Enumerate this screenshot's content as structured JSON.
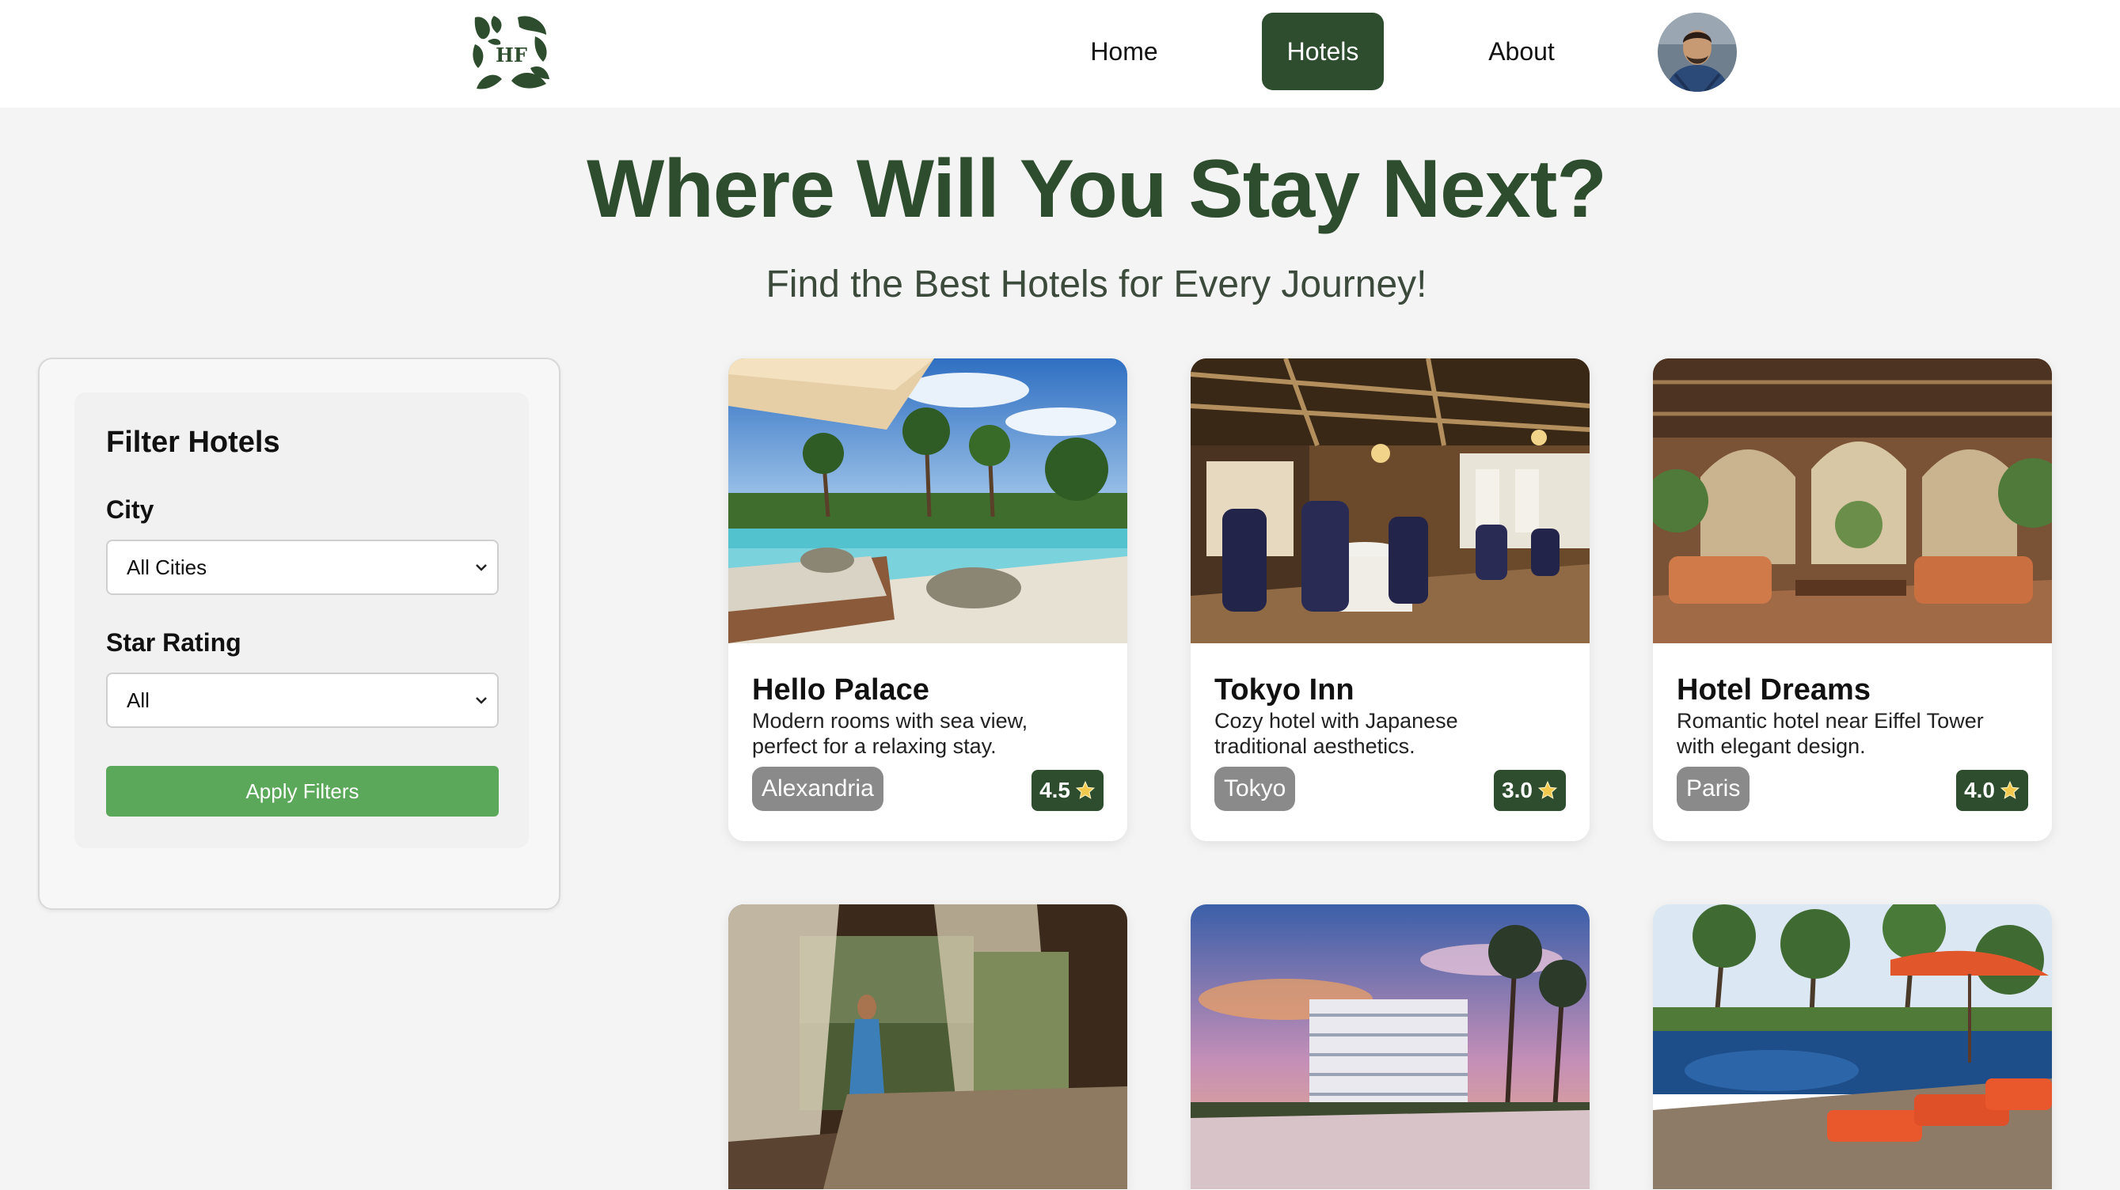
{
  "nav": {
    "logo_text": "HF",
    "items": [
      {
        "label": "Home",
        "active": false
      },
      {
        "label": "Hotels",
        "active": true
      },
      {
        "label": "About",
        "active": false
      }
    ]
  },
  "hero": {
    "title": "Where Will You Stay Next?",
    "subtitle": "Find the Best Hotels for Every Journey!"
  },
  "filter": {
    "title": "Filter Hotels",
    "city_label": "City",
    "city_value": "All Cities",
    "rating_label": "Star Rating",
    "rating_value": "All",
    "apply_label": "Apply Filters"
  },
  "hotels": [
    {
      "name": "Hello Palace",
      "description": "Modern rooms with sea view, perfect for a relaxing stay.",
      "city": "Alexandria",
      "rating": "4.5"
    },
    {
      "name": "Tokyo Inn",
      "description": "Cozy hotel with Japanese traditional aesthetics.",
      "city": "Tokyo",
      "rating": "3.0"
    },
    {
      "name": "Hotel Dreams",
      "description": "Romantic hotel near Eiffel Tower with elegant design.",
      "city": "Paris",
      "rating": "4.0"
    }
  ],
  "colors": {
    "brand_green": "#2e4d2e",
    "apply_green": "#5ca85a",
    "city_badge_gray": "#8a8a8a",
    "star_yellow": "#f2c94c"
  }
}
